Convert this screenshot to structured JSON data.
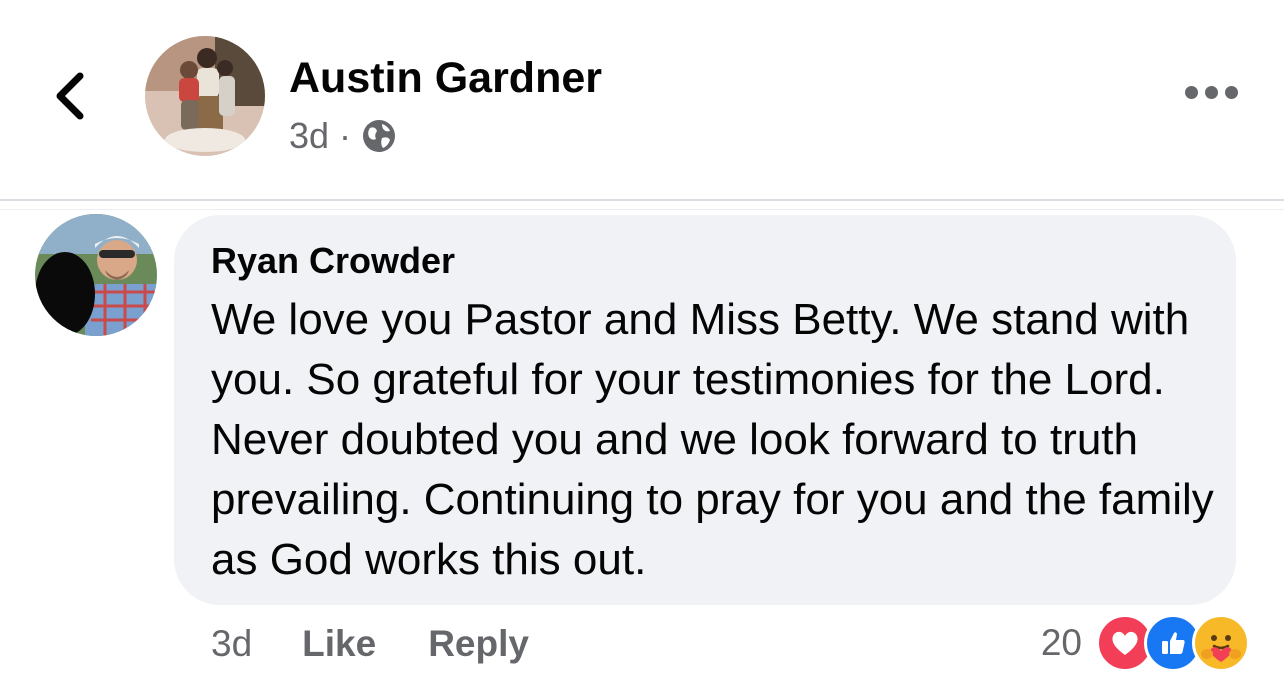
{
  "post": {
    "author": "Austin Gardner",
    "time": "3d",
    "separator": "·",
    "privacy_icon": "globe-icon"
  },
  "comment": {
    "author": "Ryan Crowder",
    "text": "We love you Pastor and Miss Betty. We stand with you. So grateful for your testimonies for the Lord. Never doubted you and we look forward to truth prevailing. Continuing to pray for you and the family as God works this out.",
    "time": "3d",
    "like_label": "Like",
    "reply_label": "Reply",
    "reaction_count": "20",
    "reactions": [
      "love-icon",
      "like-icon",
      "care-icon"
    ]
  },
  "colors": {
    "secondary_text": "#65676b",
    "bubble_bg": "#f0f2f5",
    "love_red": "#f33e58",
    "like_blue": "#1877f2",
    "care_yellow": "#f7b928"
  }
}
